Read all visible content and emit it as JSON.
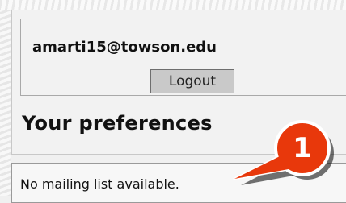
{
  "account": {
    "email": "amarti15@towson.edu",
    "logout_label": "Logout"
  },
  "preferences": {
    "heading": "Your preferences"
  },
  "mailing": {
    "message": "No mailing list available."
  },
  "callout": {
    "number": "1",
    "color": "#e8380b"
  }
}
